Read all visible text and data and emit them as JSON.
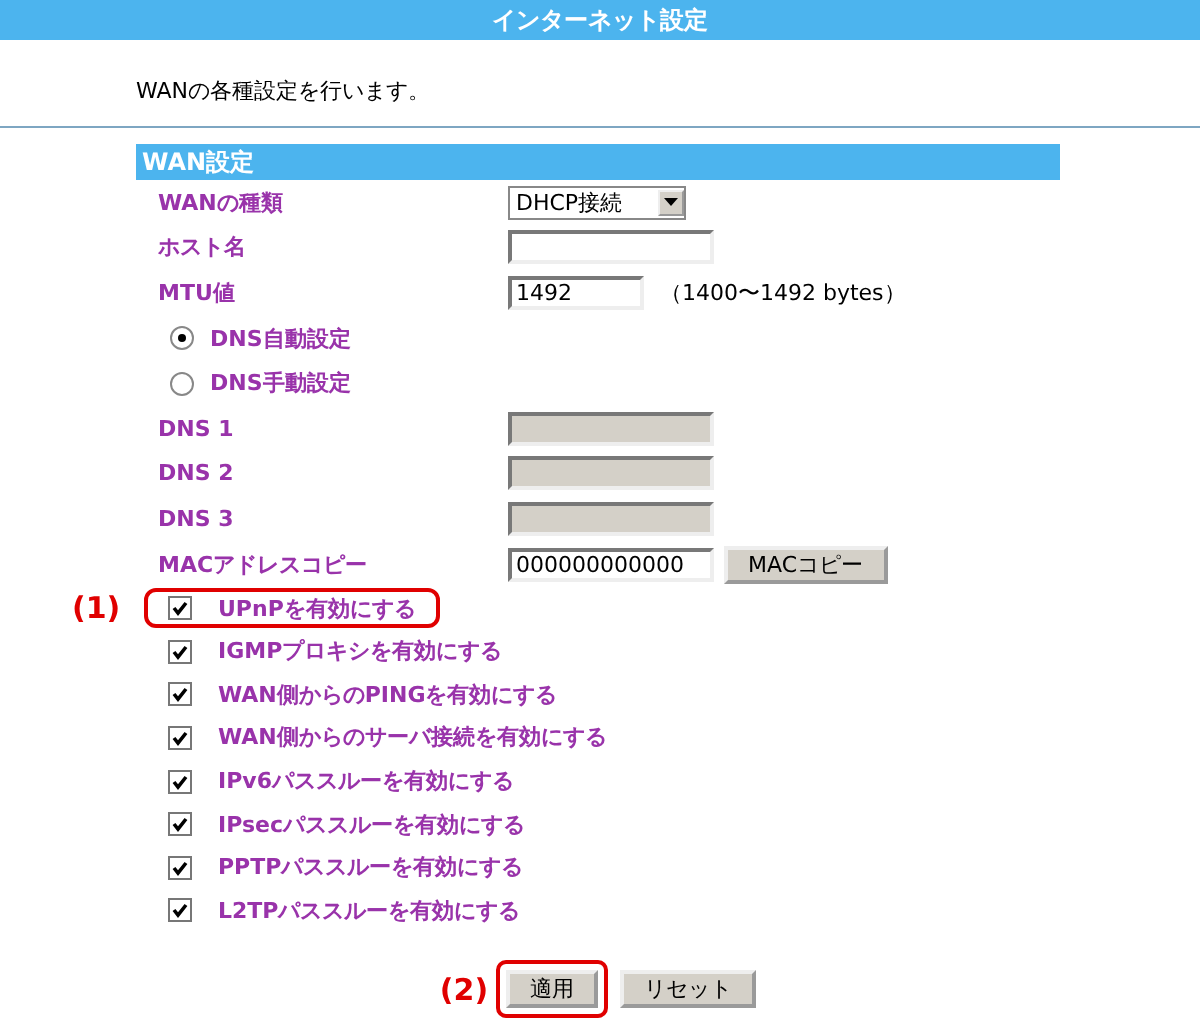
{
  "header": {
    "title": "インターネット設定"
  },
  "description": "WANの各種設定を行います。",
  "section": {
    "title": "WAN設定"
  },
  "fields": [
    {
      "kind": "select",
      "label": "WANの種類",
      "value": "DHCP接続"
    },
    {
      "kind": "text",
      "label": "ホスト名"
    },
    {
      "kind": "text",
      "label": "MTU値",
      "value": "1492",
      "note": "（1400〜1492 bytes）"
    },
    {
      "kind": "radio",
      "label": "DNS自動設定",
      "selected": true
    },
    {
      "kind": "radio",
      "label": "DNS手動設定",
      "selected": false
    },
    {
      "kind": "text",
      "label": "DNS 1",
      "disabled": true
    },
    {
      "kind": "text",
      "label": "DNS 2",
      "disabled": true
    },
    {
      "kind": "text",
      "label": "DNS 3",
      "disabled": true
    },
    {
      "kind": "text",
      "label": "MACアドレスコピー",
      "value": "000000000000",
      "button": "MACコピー"
    }
  ],
  "options": [
    {
      "label": "UPnPを有効にする",
      "checked": true,
      "callout": "(1)"
    },
    {
      "label": "IGMPプロキシを有効にする",
      "checked": true
    },
    {
      "label": "WAN側からのPINGを有効にする",
      "checked": true
    },
    {
      "label": "WAN側からのサーバ接続を有効にする",
      "checked": true
    },
    {
      "label": "IPv6パススルーを有効にする",
      "checked": true
    },
    {
      "label": "IPsecパススルーを有効にする",
      "checked": true
    },
    {
      "label": "PPTPパススルーを有効にする",
      "checked": true
    },
    {
      "label": "L2TPパススルーを有効にする",
      "checked": true
    }
  ],
  "buttons": [
    {
      "label": "適用",
      "callout": "(2)"
    },
    {
      "label": "リセット"
    }
  ]
}
